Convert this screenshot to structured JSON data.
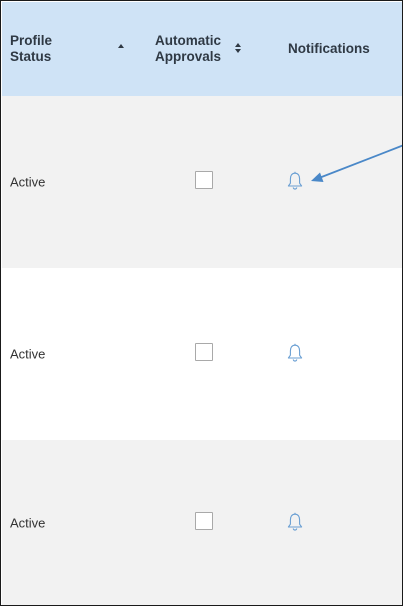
{
  "header": {
    "profile_status": [
      "Profile",
      "Status"
    ],
    "automatic_approvals": [
      "Automatic",
      "Approvals"
    ],
    "notifications": "Notifications"
  },
  "rows": [
    {
      "status": "Active",
      "automatic_approval": false,
      "notification_icon": "bell-icon"
    },
    {
      "status": "Active",
      "automatic_approval": false,
      "notification_icon": "bell-icon"
    },
    {
      "status": "Active",
      "automatic_approval": false,
      "notification_icon": "bell-icon"
    }
  ],
  "colors": {
    "header_bg": "#cfe3f6",
    "header_text": "#2f3944",
    "stripe_bg": "#f2f2f2",
    "bell_color": "#6a9fd3",
    "arrow_color": "#4a88c8"
  },
  "icons": {
    "sort_profile_status": "sort-ascending-icon",
    "sort_automatic_approvals": "sort-both-icon",
    "callout": "arrow-pointer-icon"
  }
}
